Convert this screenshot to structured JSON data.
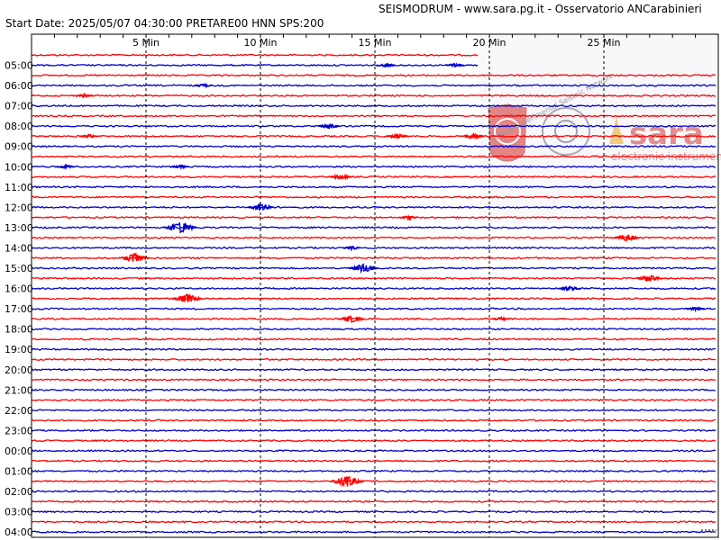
{
  "header": {
    "title": "SEISMODRUM - www.sara.pg.it - Osservatorio ANCarabinieri",
    "start_date": "Start Date: 2025/05/07 04:30:00 PRETARE00 HNN  SPS:200"
  },
  "watermark": {
    "brand": "sara",
    "subtitle": "electronic instruments",
    "seal_text": "Italian Experimental Seismic Network"
  },
  "colors": {
    "red_trace": "#ff0000",
    "blue_trace": "#0000cc",
    "frame": "#000000",
    "grid": "#000000"
  },
  "chart_data": {
    "type": "line",
    "title": "",
    "x_unit": "minutes",
    "xlim": [
      0,
      30
    ],
    "x_ticks": [
      {
        "value": 5,
        "label": "5 Min"
      },
      {
        "value": 10,
        "label": "10 Min"
      },
      {
        "value": 15,
        "label": "15 Min"
      },
      {
        "value": 20,
        "label": "20 Min"
      },
      {
        "value": 25,
        "label": "25 Min"
      }
    ],
    "hour_labels": [
      "05:00",
      "06:00",
      "07:00",
      "08:00",
      "09:00",
      "10:00",
      "11:00",
      "12:00",
      "13:00",
      "14:00",
      "15:00",
      "16:00",
      "17:00",
      "18:00",
      "19:00",
      "20:00",
      "21:00",
      "22:00",
      "23:00",
      "00:00",
      "01:00",
      "02:00",
      "03:00",
      "04:00"
    ],
    "current_trace_end_minute": 19.5,
    "events": [
      {
        "hour": "05:00",
        "half": 1,
        "minute": 15.5,
        "amp": 2
      },
      {
        "hour": "05:00",
        "half": 1,
        "minute": 18.5,
        "amp": 2
      },
      {
        "hour": "06:00",
        "half": 1,
        "minute": 7.5,
        "amp": 2
      },
      {
        "hour": "06:00",
        "half": 2,
        "minute": 2.3,
        "amp": 2
      },
      {
        "hour": "08:00",
        "half": 1,
        "minute": 13.0,
        "amp": 3
      },
      {
        "hour": "08:00",
        "half": 2,
        "minute": 16.0,
        "amp": 3
      },
      {
        "hour": "08:00",
        "half": 2,
        "minute": 19.3,
        "amp": 3
      },
      {
        "hour": "08:00",
        "half": 2,
        "minute": 2.5,
        "amp": 2
      },
      {
        "hour": "10:00",
        "half": 1,
        "minute": 1.5,
        "amp": 2
      },
      {
        "hour": "10:00",
        "half": 1,
        "minute": 6.5,
        "amp": 2
      },
      {
        "hour": "10:00",
        "half": 2,
        "minute": 13.5,
        "amp": 3
      },
      {
        "hour": "12:00",
        "half": 1,
        "minute": 10.0,
        "amp": 4
      },
      {
        "hour": "12:00",
        "half": 2,
        "minute": 16.5,
        "amp": 2
      },
      {
        "hour": "13:00",
        "half": 1,
        "minute": 6.5,
        "amp": 6
      },
      {
        "hour": "13:00",
        "half": 2,
        "minute": 26.0,
        "amp": 4
      },
      {
        "hour": "14:00",
        "half": 1,
        "minute": 14.0,
        "amp": 2
      },
      {
        "hour": "14:00",
        "half": 2,
        "minute": 4.5,
        "amp": 5
      },
      {
        "hour": "15:00",
        "half": 1,
        "minute": 14.5,
        "amp": 5
      },
      {
        "hour": "15:00",
        "half": 2,
        "minute": 27.0,
        "amp": 4
      },
      {
        "hour": "16:00",
        "half": 1,
        "minute": 23.5,
        "amp": 3
      },
      {
        "hour": "16:00",
        "half": 2,
        "minute": 6.8,
        "amp": 5
      },
      {
        "hour": "17:00",
        "half": 1,
        "minute": 29.0,
        "amp": 2
      },
      {
        "hour": "17:00",
        "half": 2,
        "minute": 14.0,
        "amp": 4
      },
      {
        "hour": "17:00",
        "half": 2,
        "minute": 20.5,
        "amp": 2
      },
      {
        "hour": "01:00",
        "half": 2,
        "minute": 13.8,
        "amp": 6
      }
    ]
  }
}
